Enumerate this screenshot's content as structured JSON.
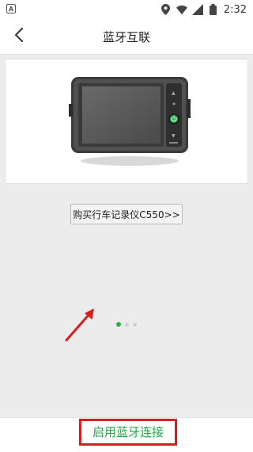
{
  "status_bar": {
    "left_icon_label": "A",
    "time": "2:32",
    "icons": [
      "location-icon",
      "wifi-icon",
      "signal-icon",
      "battery-icon"
    ]
  },
  "header": {
    "title": "蓝牙互联",
    "back_icon": "chevron-left-icon"
  },
  "product": {
    "image": "dashcam-device-image"
  },
  "buy_button": {
    "label": "购买行车记录仪C550>>"
  },
  "pager": {
    "count": 3,
    "active_index": 0
  },
  "bottom": {
    "enable_label": "启用蓝牙连接"
  },
  "colors": {
    "accent_green": "#2bb24c",
    "highlight_red": "#d71d1d",
    "background": "#ececec"
  }
}
